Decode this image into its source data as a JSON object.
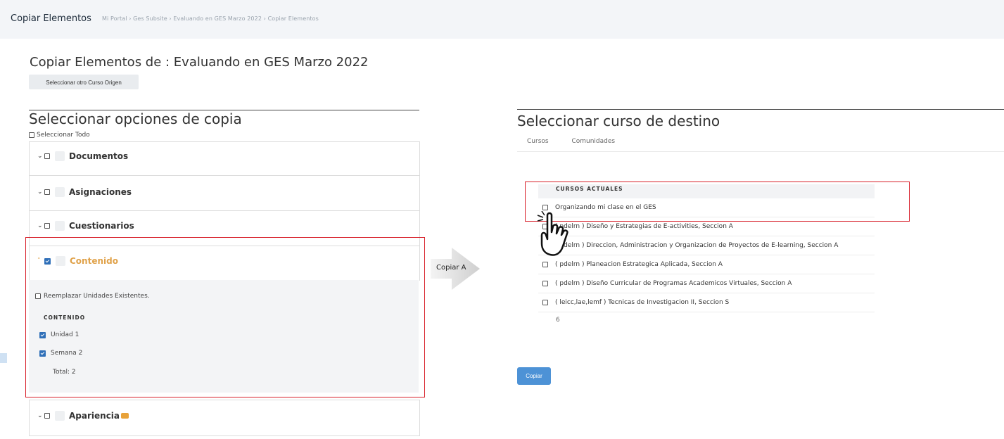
{
  "topbar": {
    "title": "Copiar Elementos",
    "breadcrumb": "Mi Portal  ›  Ges Subsite  ›  Evaluando en GES Marzo 2022  ›  Copiar Elementos"
  },
  "page": {
    "title": "Copiar Elementos de : Evaluando en GES Marzo 2022",
    "origin_button": "Seleccionar otro Curso Origen"
  },
  "options": {
    "heading": "Seleccionar opciones de copia",
    "select_all": "Seleccionar Todo",
    "items": [
      {
        "label": "Documentos",
        "checked": false
      },
      {
        "label": "Asignaciones",
        "checked": false
      },
      {
        "label": "Cuestionarios",
        "checked": false
      },
      {
        "label": "Contenido",
        "checked": true
      },
      {
        "label": "Apariencia",
        "checked": false
      }
    ],
    "replace_units": "Reemplazar Unidades Existentes.",
    "content_header": "CONTENIDO",
    "content_items": [
      {
        "label": "Unidad 1",
        "checked": true
      },
      {
        "label": "Semana 2",
        "checked": true
      }
    ],
    "total": "Total: 2"
  },
  "copy_to_label": "Copiar A",
  "destination": {
    "heading": "Seleccionar curso de destino",
    "tabs": [
      "Cursos",
      "Comunidades"
    ],
    "table_header": "CURSOS ACTUALES",
    "courses": [
      "Organizando mi clase en el GES",
      "( pdelrn ) Diseño y Estrategias de E-activities, Seccion A",
      "( pdelrn ) Direccion, Administracion y Organizacion de Proyectos de E-learning, Seccion A",
      "( pdelrn ) Planeacion Estrategica Aplicada, Seccion A",
      "( pdelrn ) Diseño Curricular de Programas Academicos Virtuales, Seccion A",
      "( leicc,lae,lemf ) Tecnicas de Investigacion II, Seccion S"
    ],
    "count": "6",
    "copy_button": "Copiar"
  },
  "colors": {
    "accent_orange": "#e0a24a",
    "highlight_red": "#d8202a",
    "primary_blue": "#4d92d6"
  }
}
